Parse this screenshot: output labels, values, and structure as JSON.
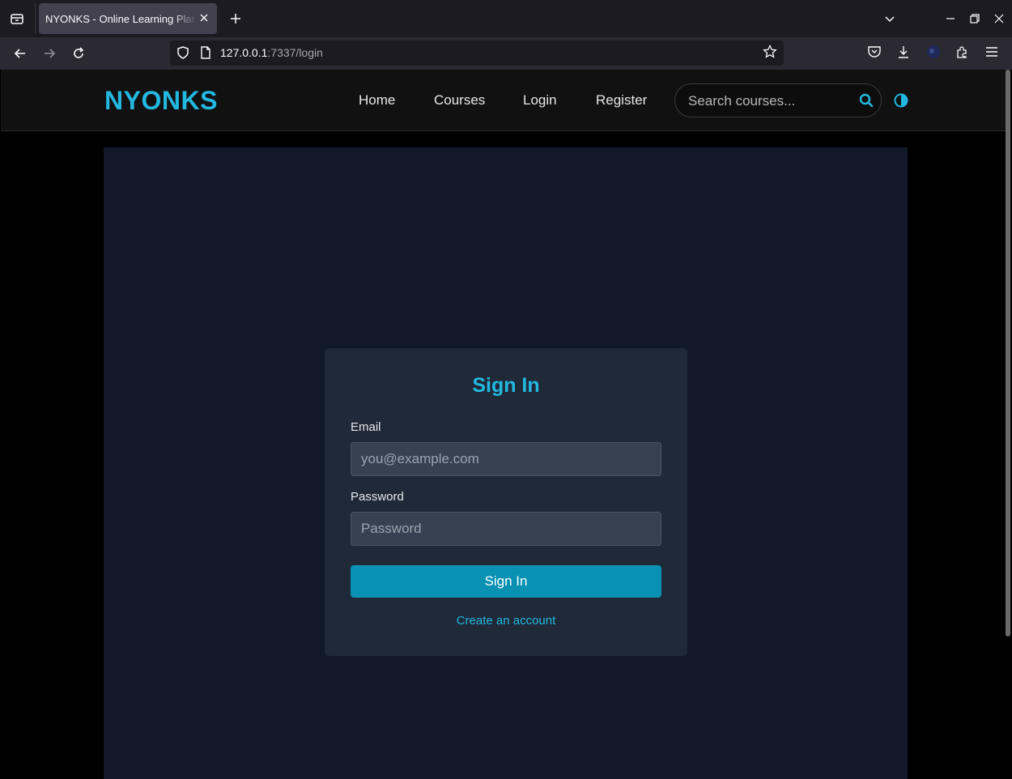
{
  "browser": {
    "tab_title": "NYONKS - Online Learning Platform",
    "url_host": "127.0.0.1",
    "url_path": ":7337/login"
  },
  "site": {
    "brand": "NYONKS",
    "nav": {
      "home": "Home",
      "courses": "Courses",
      "login": "Login",
      "register": "Register"
    },
    "search_placeholder": "Search courses...",
    "accent_color": "#22b8e0"
  },
  "login": {
    "title": "Sign In",
    "email_label": "Email",
    "email_placeholder": "you@example.com",
    "password_label": "Password",
    "password_placeholder": "Password",
    "submit_label": "Sign In",
    "create_account_link": "Create an account"
  }
}
